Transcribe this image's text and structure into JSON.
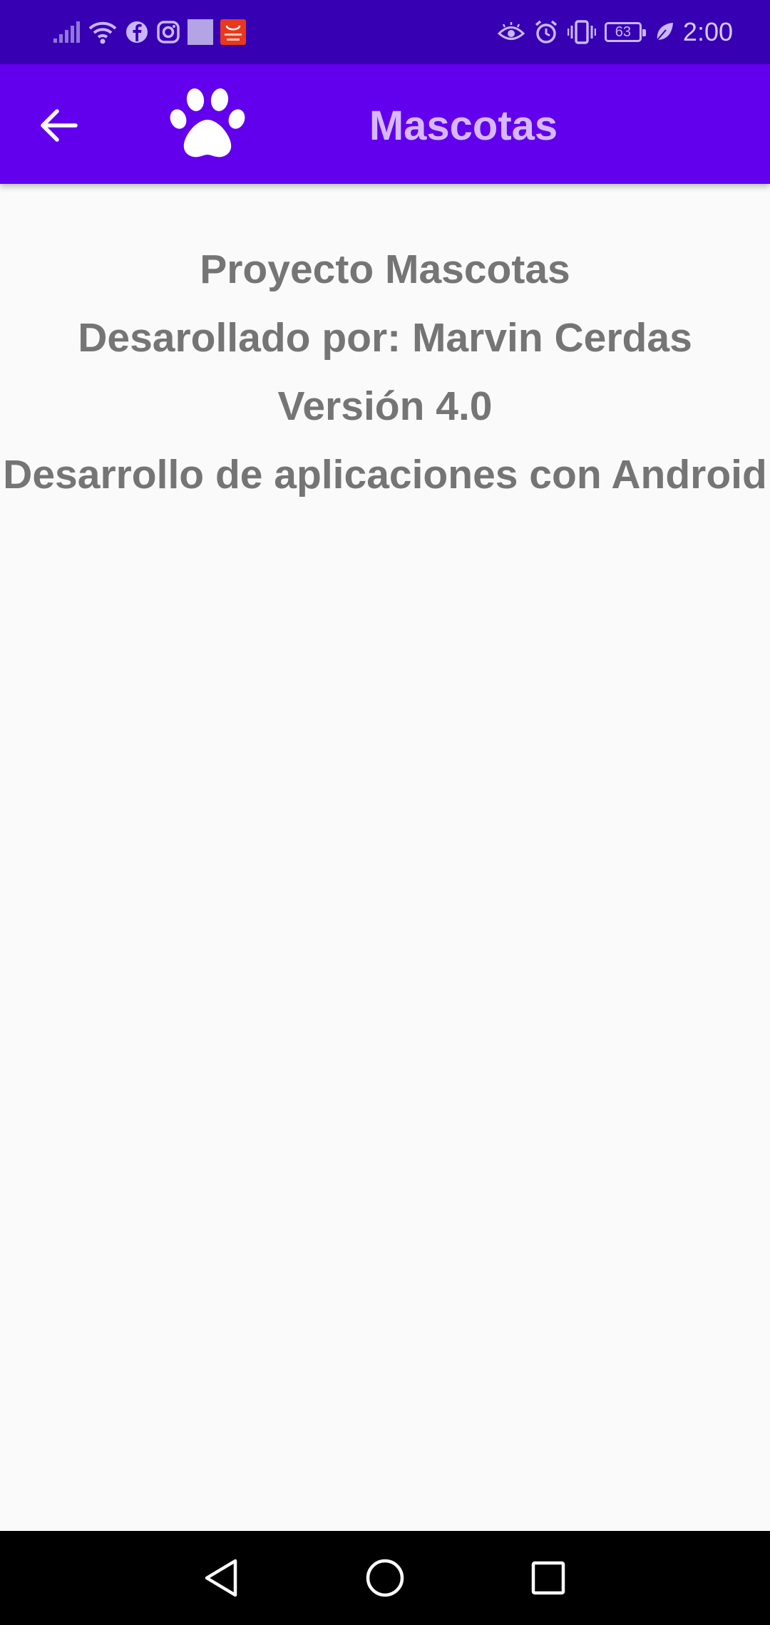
{
  "status_bar": {
    "time": "2:00",
    "battery": "63",
    "left_icons": [
      "signal-icon",
      "wifi-icon",
      "facebook-icon",
      "instagram-icon",
      "square-app-icon",
      "aliexpress-icon"
    ],
    "right_icons": [
      "eye-comfort-icon",
      "alarm-icon",
      "vibrate-icon",
      "battery-icon",
      "power-saver-leaf-icon"
    ]
  },
  "app_bar": {
    "title": "Mascotas",
    "back_icon": "arrow-back-icon",
    "logo_icon": "paw-icon",
    "color": "#6200ee",
    "status_color": "#3700b3",
    "title_color": "#d7b8ff"
  },
  "content": {
    "lines": [
      "Proyecto Mascotas",
      "Desarollado por: Marvin Cerdas",
      "Versión 4.0",
      "Desarrollo de aplicaciones con Android"
    ],
    "text_color": "#757575"
  },
  "nav_bar": {
    "buttons": [
      "back-triangle-icon",
      "home-circle-icon",
      "recents-square-icon"
    ]
  }
}
